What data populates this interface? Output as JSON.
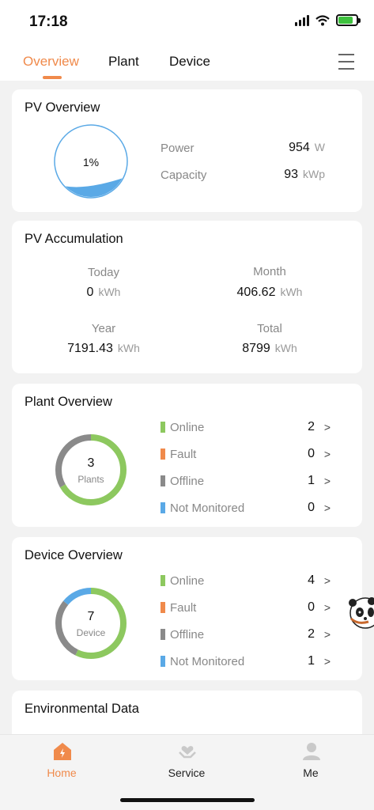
{
  "status_bar": {
    "time": "17:18"
  },
  "tabs": [
    {
      "label": "Overview",
      "active": true
    },
    {
      "label": "Plant",
      "active": false
    },
    {
      "label": "Device",
      "active": false
    }
  ],
  "pv_overview": {
    "title": "PV Overview",
    "percent_label": "1%",
    "fill_level": 0.2,
    "power_label": "Power",
    "power_value": "954",
    "power_unit": "W",
    "capacity_label": "Capacity",
    "capacity_value": "93",
    "capacity_unit": "kWp"
  },
  "pv_accumulation": {
    "title": "PV Accumulation",
    "today_label": "Today",
    "today_value": "0",
    "today_unit": "kWh",
    "month_label": "Month",
    "month_value": "406.62",
    "month_unit": "kWh",
    "year_label": "Year",
    "year_value": "7191.43",
    "year_unit": "kWh",
    "total_label": "Total",
    "total_value": "8799",
    "total_unit": "kWh"
  },
  "plant_overview": {
    "title": "Plant Overview",
    "center_value": "3",
    "center_label": "Plants",
    "rows": [
      {
        "label": "Online",
        "count": "2",
        "color": "#8dc85f"
      },
      {
        "label": "Fault",
        "count": "0",
        "color": "#f08a4b"
      },
      {
        "label": "Offline",
        "count": "1",
        "color": "#8a8a8a"
      },
      {
        "label": "Not Monitored",
        "count": "0",
        "color": "#5aa9e6"
      }
    ]
  },
  "device_overview": {
    "title": "Device Overview",
    "center_value": "7",
    "center_label": "Device",
    "rows": [
      {
        "label": "Online",
        "count": "4",
        "color": "#8dc85f"
      },
      {
        "label": "Fault",
        "count": "0",
        "color": "#f08a4b"
      },
      {
        "label": "Offline",
        "count": "2",
        "color": "#8a8a8a"
      },
      {
        "label": "Not Monitored",
        "count": "1",
        "color": "#5aa9e6"
      }
    ]
  },
  "environmental": {
    "title": "Environmental Data"
  },
  "bottom_nav": {
    "home": "Home",
    "service": "Service",
    "me": "Me",
    "active_color": "#f08a4b"
  }
}
